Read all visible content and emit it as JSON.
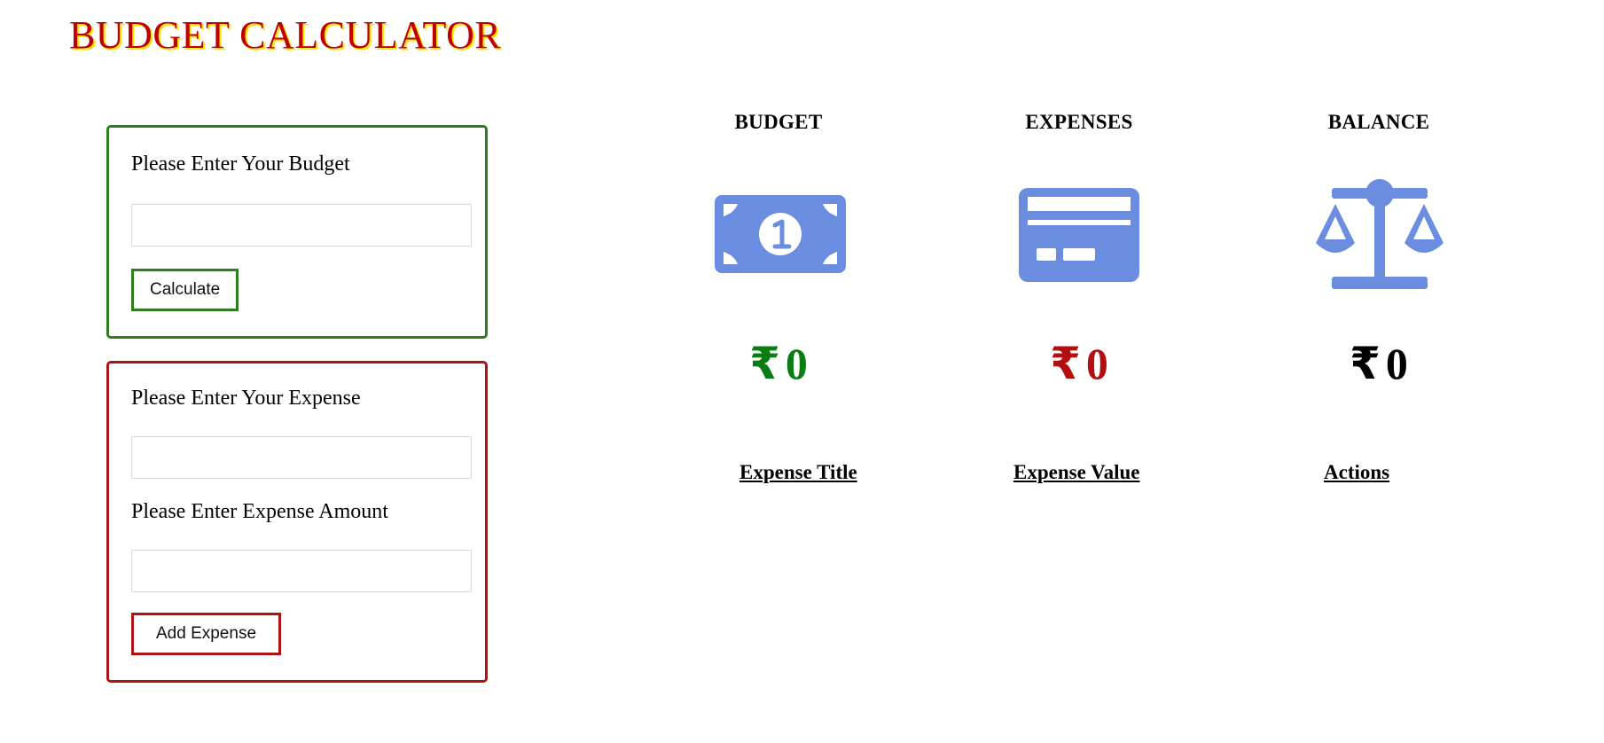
{
  "page": {
    "title": "BUDGET CALCULATOR"
  },
  "budget_form": {
    "label": "Please Enter Your Budget",
    "input_value": "",
    "button_label": "Calculate"
  },
  "expense_form": {
    "title_label": "Please Enter Your Expense",
    "title_input_value": "",
    "amount_label": "Please Enter Expense Amount",
    "amount_input_value": "",
    "button_label": "Add Expense"
  },
  "summary": {
    "currency_symbol": "₹",
    "budget": {
      "heading": "BUDGET",
      "value": "0",
      "icon": "money-bill-icon",
      "color": "#0a7d12"
    },
    "expenses": {
      "heading": "EXPENSES",
      "value": "0",
      "icon": "credit-card-icon",
      "color": "#b30f0f"
    },
    "balance": {
      "heading": "BALANCE",
      "value": "0",
      "icon": "balance-scale-icon",
      "color": "#000000"
    }
  },
  "expense_table": {
    "headers": [
      "Expense Title",
      "Expense Value",
      "Actions"
    ],
    "rows": []
  },
  "colors": {
    "title": "#c00000",
    "title_shadow": "#ffe600",
    "budget_accent": "#2e7d1f",
    "expense_accent": "#b01313",
    "icon": "#6a8de0"
  }
}
